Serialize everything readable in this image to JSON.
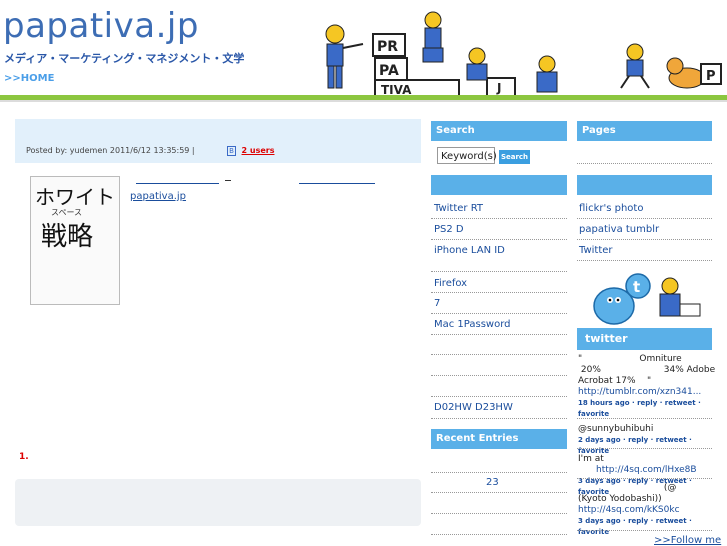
{
  "header": {
    "logo": "papativa.jp",
    "tagline": "メディア・マーケティング・マネジメント・文学",
    "home_link": ">>HOME",
    "sign_letters": [
      "PR",
      "PA",
      "TIVA",
      "J",
      "P"
    ]
  },
  "post": {
    "meta": "Posted by: yudemen   2011/6/12   13:35:59      |",
    "hatena_badge": "B",
    "users": "2 users",
    "link": "papativa.jp",
    "list_number": "1.",
    "book": {
      "title_line1": "ホワイト",
      "title_line2": "スペース",
      "title_line3": "戦略"
    }
  },
  "sidebar_left": {
    "search_heading": "Search",
    "search_placeholder": "Keyword(s)",
    "search_button": "Search",
    "items": [
      "Twitter  RT",
      "PS2          D",
      "iPhone     LAN                ID",
      "Firefox",
      "7",
      "Mac          1Password",
      "D02HW    D23HW"
    ],
    "recent_heading": "Recent Entries",
    "recent_items": [
      "23"
    ]
  },
  "sidebar_right": {
    "pages_heading": "Pages",
    "links": [
      "flickr's photo",
      "papativa tumblr",
      "Twitter"
    ],
    "twitter_heading": "twitter",
    "tweets": [
      {
        "text": "\"                    Omniture\n 20%                      34% Adobe\nAcrobat 17%    \"",
        "link": "http://tumblr.com/xzn341...",
        "meta": "18 hours ago · reply · retweet · favorite"
      },
      {
        "text": "@sunnybuhibuhi",
        "link": "",
        "meta": "2 days ago · reply · retweet · favorite"
      },
      {
        "text": "I'm at",
        "link": "http://4sq.com/lHxe8B",
        "meta": "3 days ago · reply · retweet · favorite"
      },
      {
        "text": "                              (@\n(Kyoto Yodobashi))",
        "link": "http://4sq.com/kKS0kc",
        "meta": "3 days ago · reply · retweet · favorite"
      }
    ],
    "follow": ">>Follow me"
  }
}
